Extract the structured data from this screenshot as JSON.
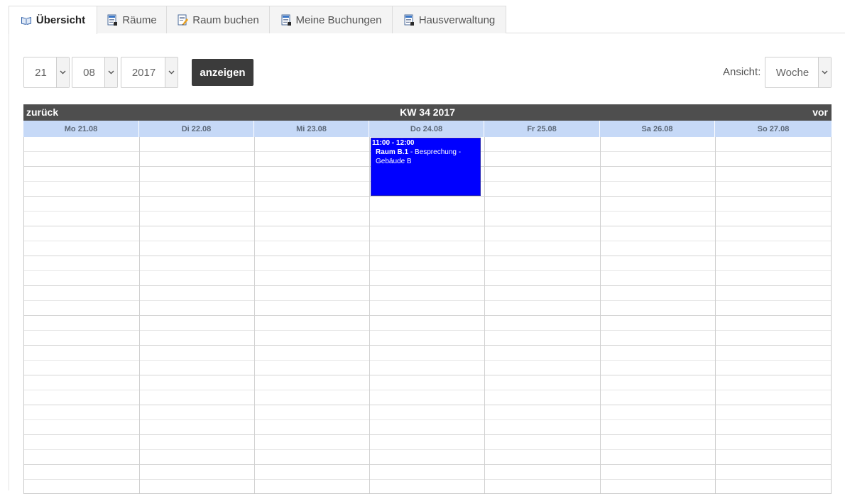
{
  "tabs": [
    {
      "label": "Übersicht",
      "active": true,
      "icon": "book-icon"
    },
    {
      "label": "Räume",
      "active": false,
      "icon": "document-icon"
    },
    {
      "label": "Raum buchen",
      "active": false,
      "icon": "edit-document-icon"
    },
    {
      "label": "Meine Buchungen",
      "active": false,
      "icon": "document-icon"
    },
    {
      "label": "Hausverwaltung",
      "active": false,
      "icon": "document-icon"
    }
  ],
  "controls": {
    "day": "21",
    "month": "08",
    "year": "2017",
    "show_button": "anzeigen",
    "view_label": "Ansicht:",
    "view_value": "Woche"
  },
  "calendar": {
    "prev": "zurück",
    "next": "vor",
    "week_title": "KW 34 2017",
    "days": [
      "Mo 21.08",
      "Di 22.08",
      "Mi 23.08",
      "Do 24.08",
      "Fr 25.08",
      "Sa 26.08",
      "So 27.08"
    ],
    "event": {
      "time": "11:00 - 12:00",
      "room": "Raum B.1",
      "separator": " - ",
      "description": "Besprechung - Gebäude B",
      "color": "#0000ff"
    }
  },
  "colors": {
    "header_bg": "#4e4e4e",
    "dayrow_bg": "#c6d9f7",
    "button_bg": "#3b3b3b"
  }
}
